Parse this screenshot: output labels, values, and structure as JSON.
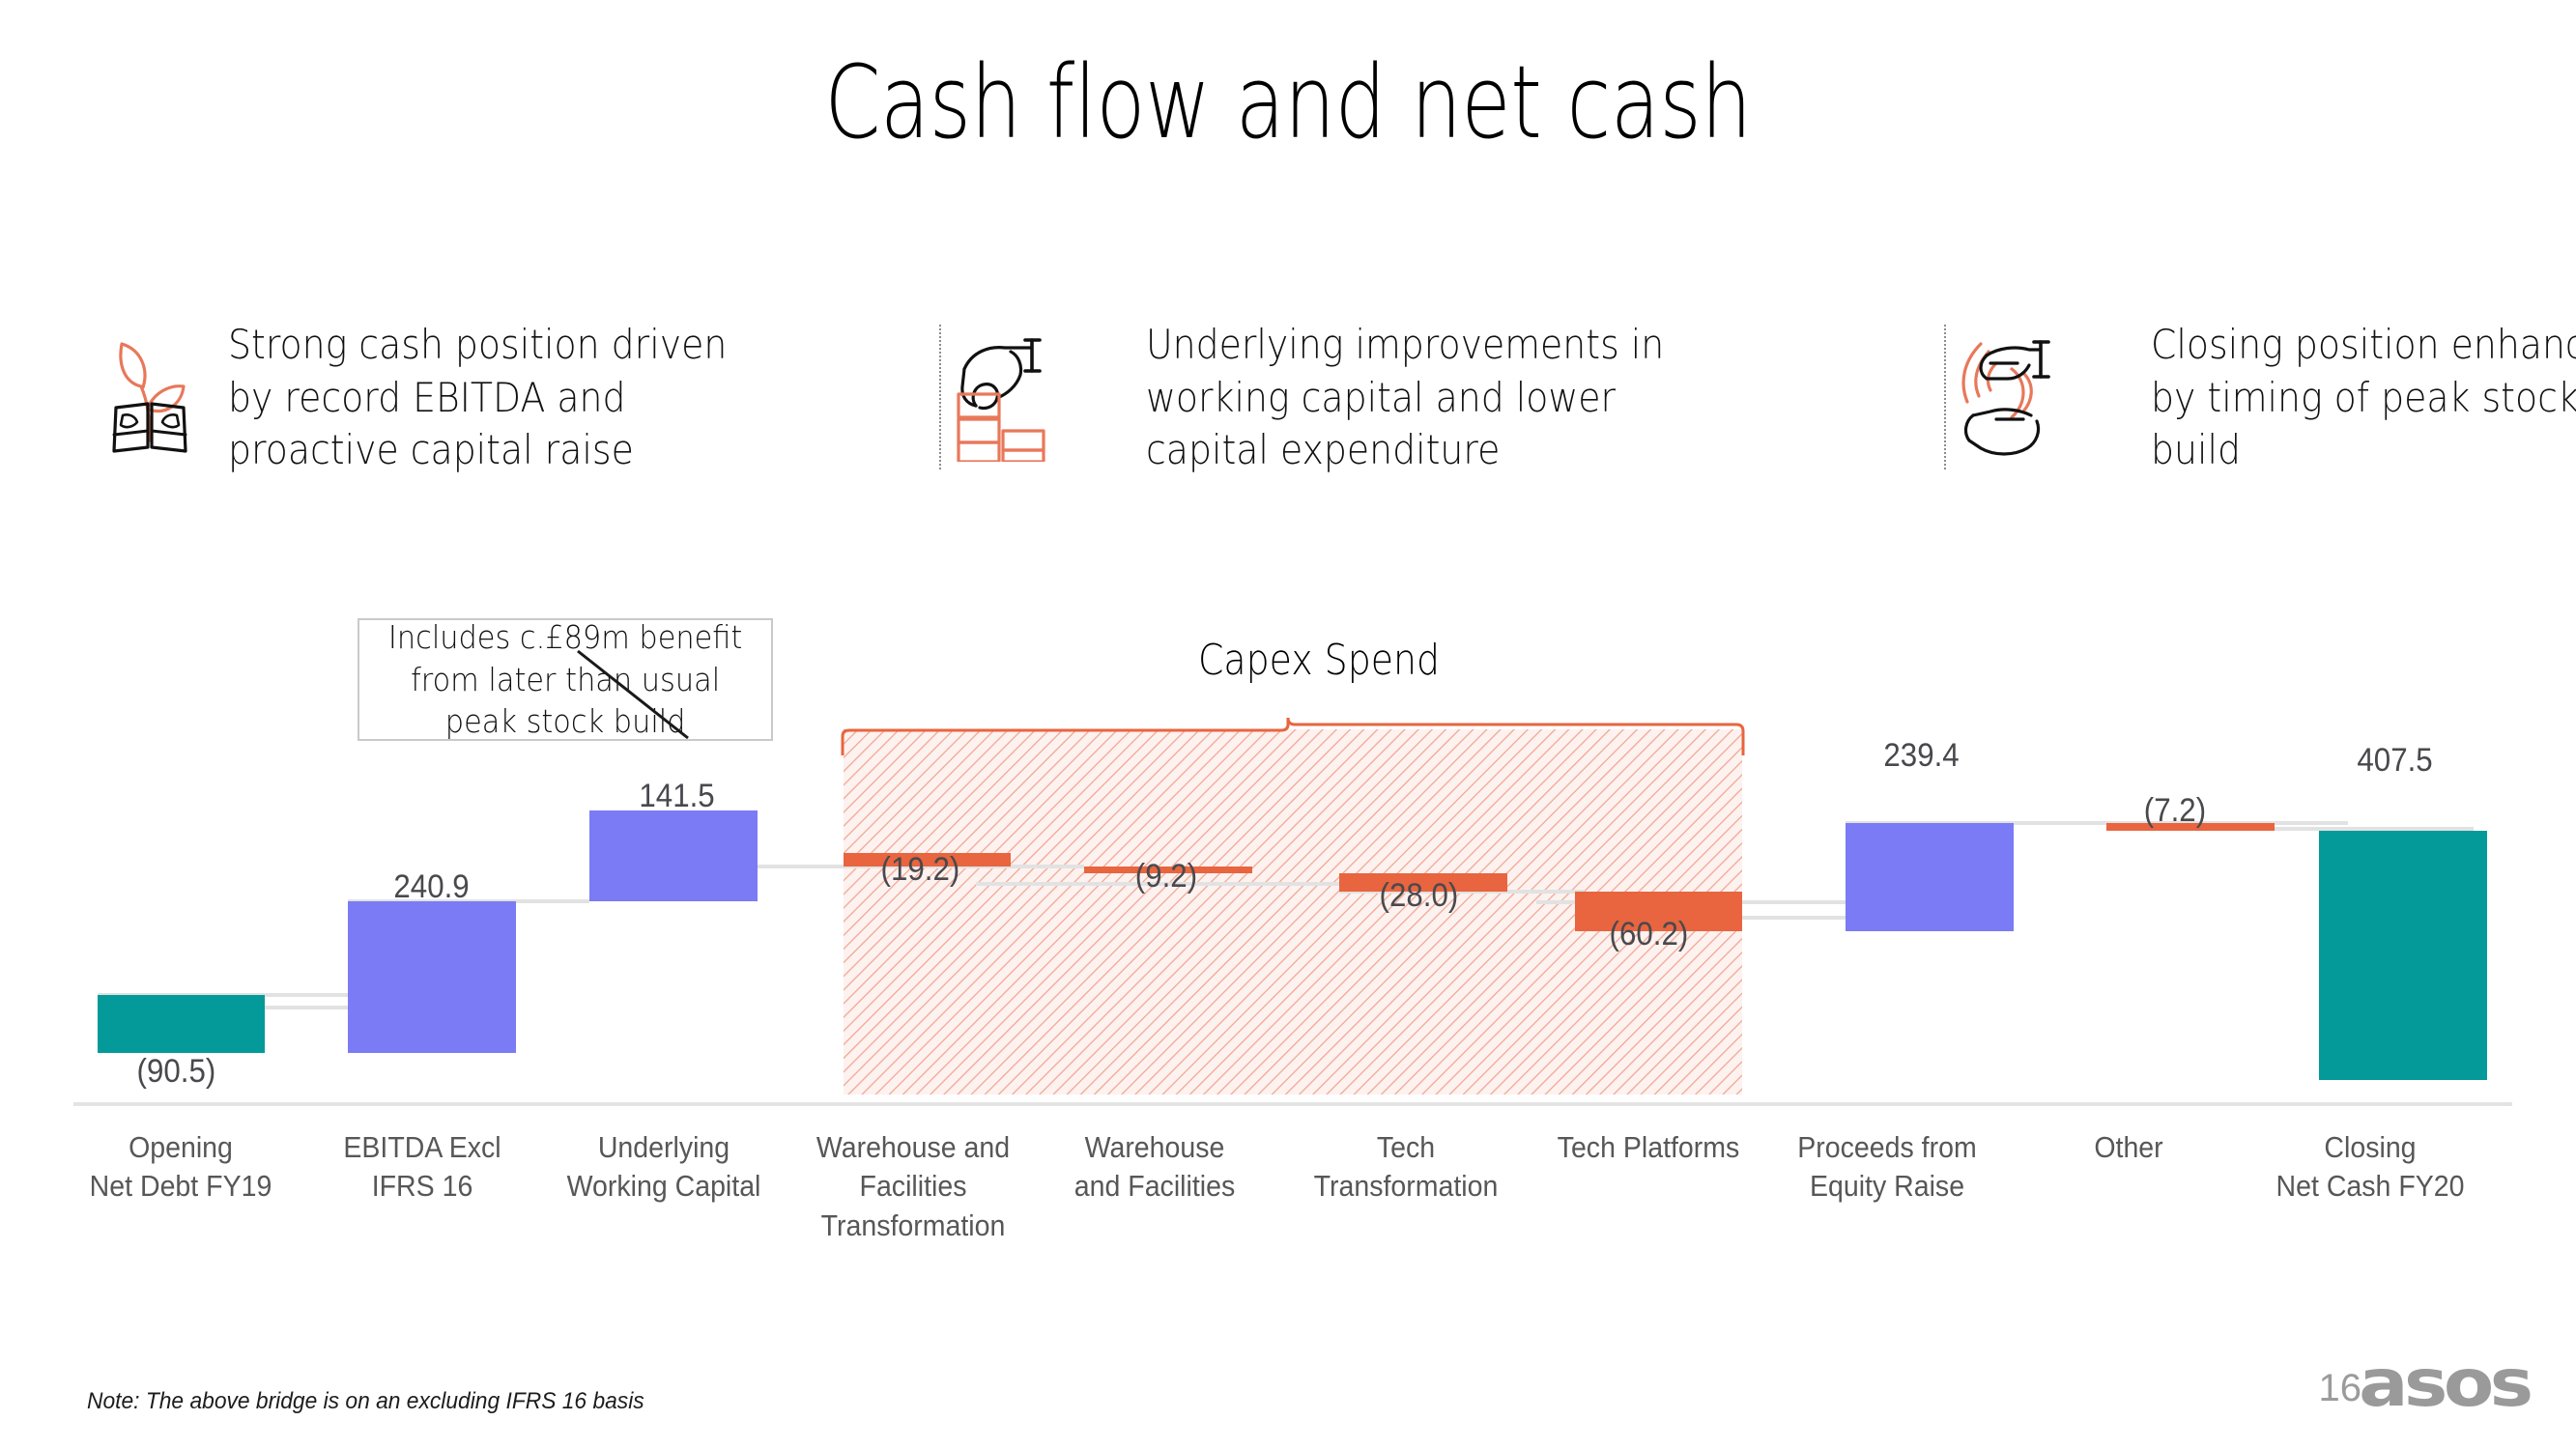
{
  "slide": {
    "title": "Cash flow and net cash",
    "page_number": "16",
    "logo": "asos",
    "note": "Note: The above bridge is on an excluding IFRS 16 basis"
  },
  "bullets": [
    {
      "icon": "plant-money-icon",
      "text": "Strong cash position driven\nby record EBITDA and\nproactive capital raise"
    },
    {
      "icon": "hand-stacking-blocks-icon",
      "text": "Underlying improvements in\nworking capital and lower\ncapital expenditure"
    },
    {
      "icon": "hands-exchange-icon",
      "text": "Closing position enhanced\nby timing of peak stock\nbuild"
    }
  ],
  "annotations": {
    "callout": "Includes c.£89m benefit\nfrom later than usual\npeak stock build",
    "capex_bracket": "Capex Spend"
  },
  "chart_data": {
    "type": "bar",
    "chart_subtype": "waterfall",
    "title": "Cash flow and net cash",
    "xlabel": "",
    "ylabel": "",
    "grid": false,
    "legend": false,
    "ylim": [
      -150,
      440
    ],
    "categories": [
      "Opening\nNet Debt FY19",
      "EBITDA Excl IFRS 16",
      "Underlying\nWorking Capital",
      "Warehouse and\nFacilities\nTransformation",
      "Warehouse\nand Facilities",
      "Tech Transformation",
      "Tech Platforms",
      "Proceeds from\nEquity Raise",
      "Other",
      "Closing\nNet Cash FY20"
    ],
    "labels": [
      "(90.5)",
      "240.9",
      "141.5",
      "(19.2)",
      "(9.2)",
      "(28.0)",
      "(60.2)",
      "239.4",
      "(7.2)",
      "407.5"
    ],
    "values": [
      -90.5,
      240.9,
      141.5,
      -19.2,
      -9.2,
      -28.0,
      -60.2,
      239.4,
      -7.2,
      407.5
    ],
    "bar_types": [
      "total",
      "increase",
      "increase",
      "decrease",
      "decrease",
      "decrease",
      "decrease",
      "increase",
      "decrease",
      "total"
    ],
    "cumulative_start": [
      0,
      -90.5,
      150.4,
      291.9,
      272.7,
      263.5,
      235.5,
      175.3,
      414.7,
      0
    ],
    "cumulative_end": [
      -90.5,
      150.4,
      291.9,
      272.7,
      263.5,
      235.5,
      175.3,
      414.7,
      407.5,
      407.5
    ],
    "colors": {
      "total": "#039A99",
      "increase": "#7B7BF5",
      "decrease": "#E8653F",
      "connector": "#E2E2E2",
      "axis": "#E4E4E4",
      "hatch": "#E8653F",
      "label_text": "#49494d"
    },
    "capex_region": {
      "label": "Capex Spend",
      "categories": [
        3,
        4,
        5,
        6
      ]
    }
  }
}
